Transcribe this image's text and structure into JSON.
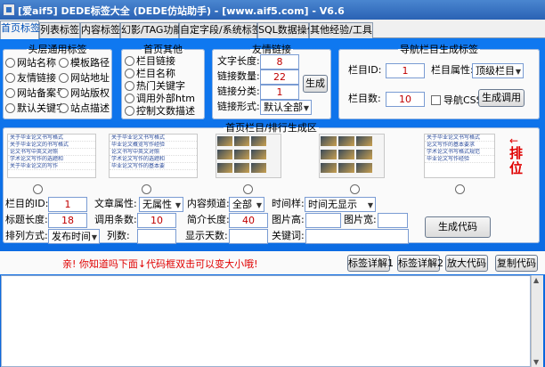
{
  "window": {
    "title": "[爱aif5] DEDE标签大全 (DEDE仿站助手) - [www.aif5.com] - V6.6"
  },
  "tabs": [
    {
      "label": "首页标签"
    },
    {
      "label": "列表标签"
    },
    {
      "label": "内容标签"
    },
    {
      "label": "幻影/TAG功能"
    },
    {
      "label": "自定字段/系统标签"
    },
    {
      "label": "SQL数据操作"
    },
    {
      "label": "其他经验/工具"
    }
  ],
  "header_tags": {
    "title": "头层通用标签",
    "options": [
      "网站名称",
      "模板路径",
      "友情链接",
      "网站地址",
      "网站备案号",
      "网站版权",
      "默认关键字",
      "站点描述"
    ]
  },
  "home_other": {
    "title": "首页其他",
    "options": [
      "栏目链接",
      "栏目名称",
      "热门关键字",
      "调用外部htm",
      "控制文数描述"
    ]
  },
  "friend_link": {
    "title": "友情链接",
    "text_length_label": "文字长度:",
    "text_length": "8",
    "link_count_label": "链接数量:",
    "link_count": "22",
    "link_type_label": "链接分类:",
    "link_type": "1",
    "link_form_label": "链接形式:",
    "link_form": "默认全部",
    "generate_label": "生成"
  },
  "nav": {
    "title": "导航栏目生成标签",
    "column_id_label": "栏目ID:",
    "column_id": "1",
    "column_attr_label": "栏目属性:",
    "column_attr": "顶级栏目",
    "column_count_label": "栏目数:",
    "column_count": "10",
    "nav_css_label": "导航CSS",
    "generate_label": "生成调用"
  },
  "listgen": {
    "title": "首页栏目/排行生成区",
    "thumb1": [
      "关于毕业论文书写格式",
      "关于毕业论文的书写格式",
      "论文书写中英文对照",
      "学术论文写作的选题和",
      "关于毕业论文的写作"
    ],
    "thumb2": [
      "关于毕业论文书写格式",
      "毕业论文概览写作经验",
      "论文书写中英文对照",
      "学术论文写作的选题和",
      "毕业论文写作的基本要"
    ],
    "thumb5": [
      "关于毕业论文书写格式",
      "论文写作的基本要求",
      "学术论文书写格式规范",
      "毕业论文写作经验"
    ],
    "rank_label": "排位",
    "column_id_label": "栏目的ID:",
    "column_id": "1",
    "article_attr_label": "文章属性:",
    "article_attr": "无属性",
    "content_channel_label": "内容频道:",
    "content_channel": "全部",
    "time_label": "时间样:",
    "time_value": "时间无显示",
    "title_len_label": "标题长度:",
    "title_len": "18",
    "call_count_label": "调用条数:",
    "call_count": "10",
    "summary_len_label": "简介长度:",
    "summary_len": "40",
    "img_h_label": "图片高:",
    "img_h": "",
    "img_w_label": "图片宽:",
    "img_w": "",
    "sort_label": "排列方式:",
    "sort_value": "发布时间",
    "col_count_label": "列数:",
    "col_count": "",
    "days_label": "显示天数:",
    "days": "",
    "keyword_label": "关键词:",
    "keyword": "",
    "generate_label": "生成代码"
  },
  "bottom": {
    "tip": "亲! 你知道吗下面↓代码框双击可以变大小哦!",
    "buttons": [
      "标签详解1",
      "标签详解2",
      "放大代码",
      "复制代码"
    ]
  },
  "colors": {
    "panel_blue": "#0f78f0",
    "tip_red": "#e00000",
    "rank_red": "#e00000",
    "input_red": "#c00000"
  }
}
